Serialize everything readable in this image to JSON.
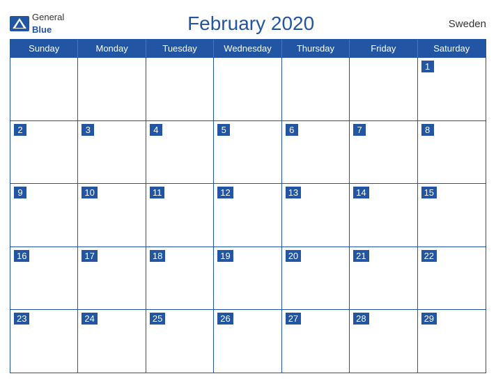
{
  "header": {
    "logo_general": "General",
    "logo_blue": "Blue",
    "title": "February 2020",
    "country": "Sweden"
  },
  "days_of_week": [
    "Sunday",
    "Monday",
    "Tuesday",
    "Wednesday",
    "Thursday",
    "Friday",
    "Saturday"
  ],
  "weeks": [
    [
      null,
      null,
      null,
      null,
      null,
      null,
      1
    ],
    [
      2,
      3,
      4,
      5,
      6,
      7,
      8
    ],
    [
      9,
      10,
      11,
      12,
      13,
      14,
      15
    ],
    [
      16,
      17,
      18,
      19,
      20,
      21,
      22
    ],
    [
      23,
      24,
      25,
      26,
      27,
      28,
      29
    ]
  ]
}
